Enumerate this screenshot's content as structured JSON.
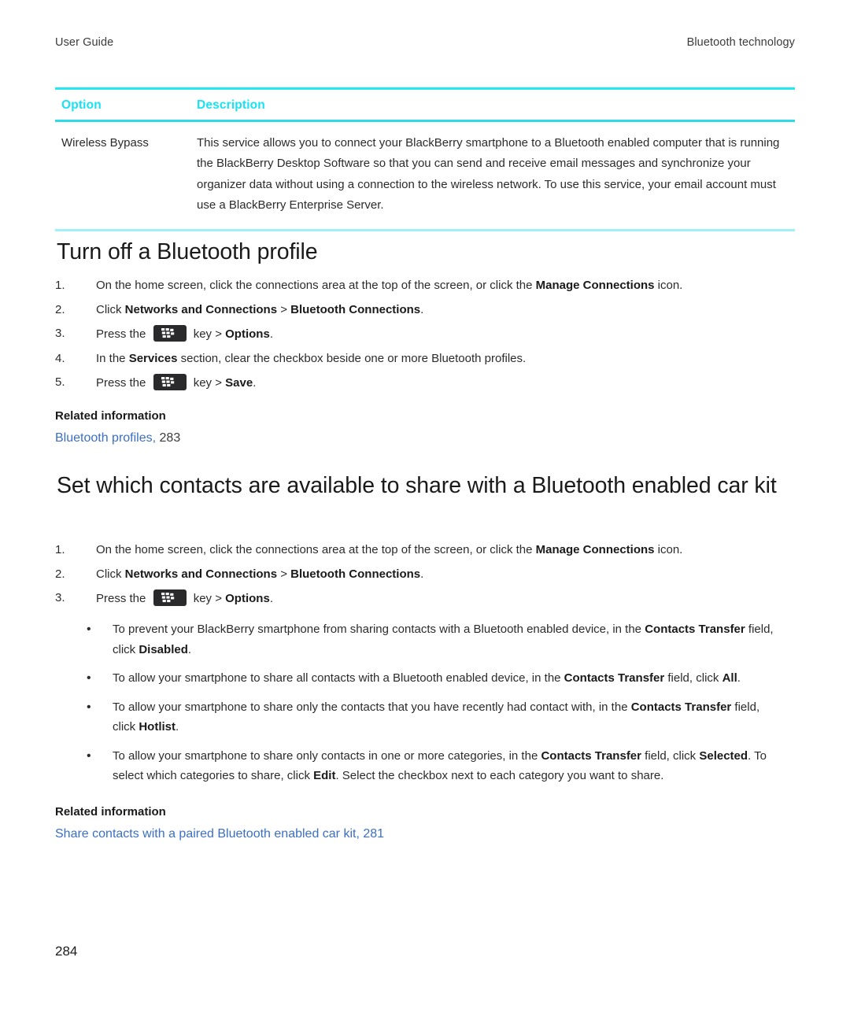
{
  "header": {
    "left": "User Guide",
    "right": "Bluetooth technology"
  },
  "colors": {
    "table_header_accent": "#18e3f2",
    "rule_top": "#22e9f5",
    "rule_mid": "#2ddbe8",
    "rule_bottom": "#9ff0f7",
    "link": "#3b6fc4",
    "body_text": "#2b2b2b",
    "key_icon_bg": "#2a2a2c"
  },
  "table": {
    "columns": [
      "Option",
      "Description"
    ],
    "rows": [
      {
        "option": "Wireless Bypass",
        "description": "This service allows you to connect your BlackBerry smartphone to a Bluetooth enabled computer that is running the BlackBerry Desktop Software so that you can send and receive email messages and synchronize your organizer data without using a connection to the wireless network. To use this service, your email account must use a BlackBerry Enterprise Server."
      }
    ]
  },
  "sections": [
    {
      "heading": "Turn off a Bluetooth profile",
      "steps": [
        {
          "num": "1.",
          "html": "On the home screen, click the connections area at the top of the screen, or click the <b>Manage Connections</b> icon."
        },
        {
          "num": "2.",
          "html": "Click <b>Networks and Connections</b> &gt; <b>Bluetooth Connections</b>."
        },
        {
          "num": "3.",
          "html": "Press the <span class=\"bb-key\" data-name=\"blackberry-menu-key-icon\" data-interactable=\"false\"><svg width=\"22\" height=\"13\" viewBox=\"0 0 22 13\"><rect x=\"0\" y=\"0\" width=\"4.2\" height=\"3.1\" fill=\"#ffffff\"/><rect x=\"5.6\" y=\"0\" width=\"4.2\" height=\"3.1\" fill=\"#ffffff\"/><rect x=\"11.2\" y=\"0.8\" width=\"4.2\" height=\"3.1\" fill=\"#ffffff\"/><rect x=\"0.8\" y=\"4.5\" width=\"4.2\" height=\"3.1\" fill=\"#ffffff\"/><rect x=\"6.4\" y=\"4.5\" width=\"4.2\" height=\"3.1\" fill=\"#ffffff\"/><rect x=\"12\" y=\"5.3\" width=\"4.2\" height=\"3.1\" fill=\"#ffffff\"/><rect x=\"1.6\" y=\"9\" width=\"4.2\" height=\"3.1\" fill=\"#ffffff\"/><rect x=\"7.2\" y=\"9\" width=\"4.2\" height=\"3.1\" fill=\"#ffffff\"/></svg></span> key &gt; <b>Options</b>."
        },
        {
          "num": "4.",
          "html": "In the <b>Services</b> section, clear the checkbox beside one or more Bluetooth profiles."
        },
        {
          "num": "5.",
          "html": "Press the <span class=\"bb-key\" data-name=\"blackberry-menu-key-icon\" data-interactable=\"false\"><svg width=\"22\" height=\"13\" viewBox=\"0 0 22 13\"><rect x=\"0\" y=\"0\" width=\"4.2\" height=\"3.1\" fill=\"#ffffff\"/><rect x=\"5.6\" y=\"0\" width=\"4.2\" height=\"3.1\" fill=\"#ffffff\"/><rect x=\"11.2\" y=\"0.8\" width=\"4.2\" height=\"3.1\" fill=\"#ffffff\"/><rect x=\"0.8\" y=\"4.5\" width=\"4.2\" height=\"3.1\" fill=\"#ffffff\"/><rect x=\"6.4\" y=\"4.5\" width=\"4.2\" height=\"3.1\" fill=\"#ffffff\"/><rect x=\"12\" y=\"5.3\" width=\"4.2\" height=\"3.1\" fill=\"#ffffff\"/><rect x=\"1.6\" y=\"9\" width=\"4.2\" height=\"3.1\" fill=\"#ffffff\"/><rect x=\"7.2\" y=\"9\" width=\"4.2\" height=\"3.1\" fill=\"#ffffff\"/></svg></span> key &gt; <b>Save</b>."
        }
      ],
      "related": {
        "title": "Related information",
        "link": "Bluetooth profiles,",
        "page": "283",
        "page_is_link": false
      }
    },
    {
      "heading": "Set which contacts are available to share with a Bluetooth enabled car kit",
      "steps": [
        {
          "num": "1.",
          "html": "On the home screen, click the connections area at the top of the screen, or click the <b>Manage Connections</b> icon."
        },
        {
          "num": "2.",
          "html": "Click <b>Networks and Connections</b> &gt; <b>Bluetooth Connections</b>."
        },
        {
          "num": "3.",
          "html": "Press the <span class=\"bb-key\" data-name=\"blackberry-menu-key-icon\" data-interactable=\"false\"><svg width=\"22\" height=\"13\" viewBox=\"0 0 22 13\"><rect x=\"0\" y=\"0\" width=\"4.2\" height=\"3.1\" fill=\"#ffffff\"/><rect x=\"5.6\" y=\"0\" width=\"4.2\" height=\"3.1\" fill=\"#ffffff\"/><rect x=\"11.2\" y=\"0.8\" width=\"4.2\" height=\"3.1\" fill=\"#ffffff\"/><rect x=\"0.8\" y=\"4.5\" width=\"4.2\" height=\"3.1\" fill=\"#ffffff\"/><rect x=\"6.4\" y=\"4.5\" width=\"4.2\" height=\"3.1\" fill=\"#ffffff\"/><rect x=\"12\" y=\"5.3\" width=\"4.2\" height=\"3.1\" fill=\"#ffffff\"/><rect x=\"1.6\" y=\"9\" width=\"4.2\" height=\"3.1\" fill=\"#ffffff\"/><rect x=\"7.2\" y=\"9\" width=\"4.2\" height=\"3.1\" fill=\"#ffffff\"/></svg></span> key &gt; <b>Options</b>."
        }
      ],
      "bullets": [
        {
          "marker": "•",
          "html": "To prevent your BlackBerry smartphone from sharing contacts with a Bluetooth enabled device, in the <b>Contacts Transfer</b> field, click <b>Disabled</b>."
        },
        {
          "marker": "•",
          "html": "To allow your smartphone to share all contacts with a Bluetooth enabled device, in the <b>Contacts Transfer</b> field, click <b>All</b>."
        },
        {
          "marker": "•",
          "html": "To allow your smartphone to share only the contacts that you have recently had contact with, in the <b>Contacts Transfer</b> field, click <b>Hotlist</b>."
        },
        {
          "marker": "•",
          "html": "To allow your smartphone to share only contacts in one or more categories, in the <b>Contacts Transfer</b> field, click <b>Selected</b>. To select which categories to share, click <b>Edit</b>. Select the checkbox next to each category you want to share."
        }
      ],
      "related": {
        "title": "Related information",
        "link": "Share contacts with a paired Bluetooth enabled car kit,",
        "page": "281",
        "page_is_link": true
      }
    }
  ],
  "footer": {
    "page_number": "284"
  }
}
